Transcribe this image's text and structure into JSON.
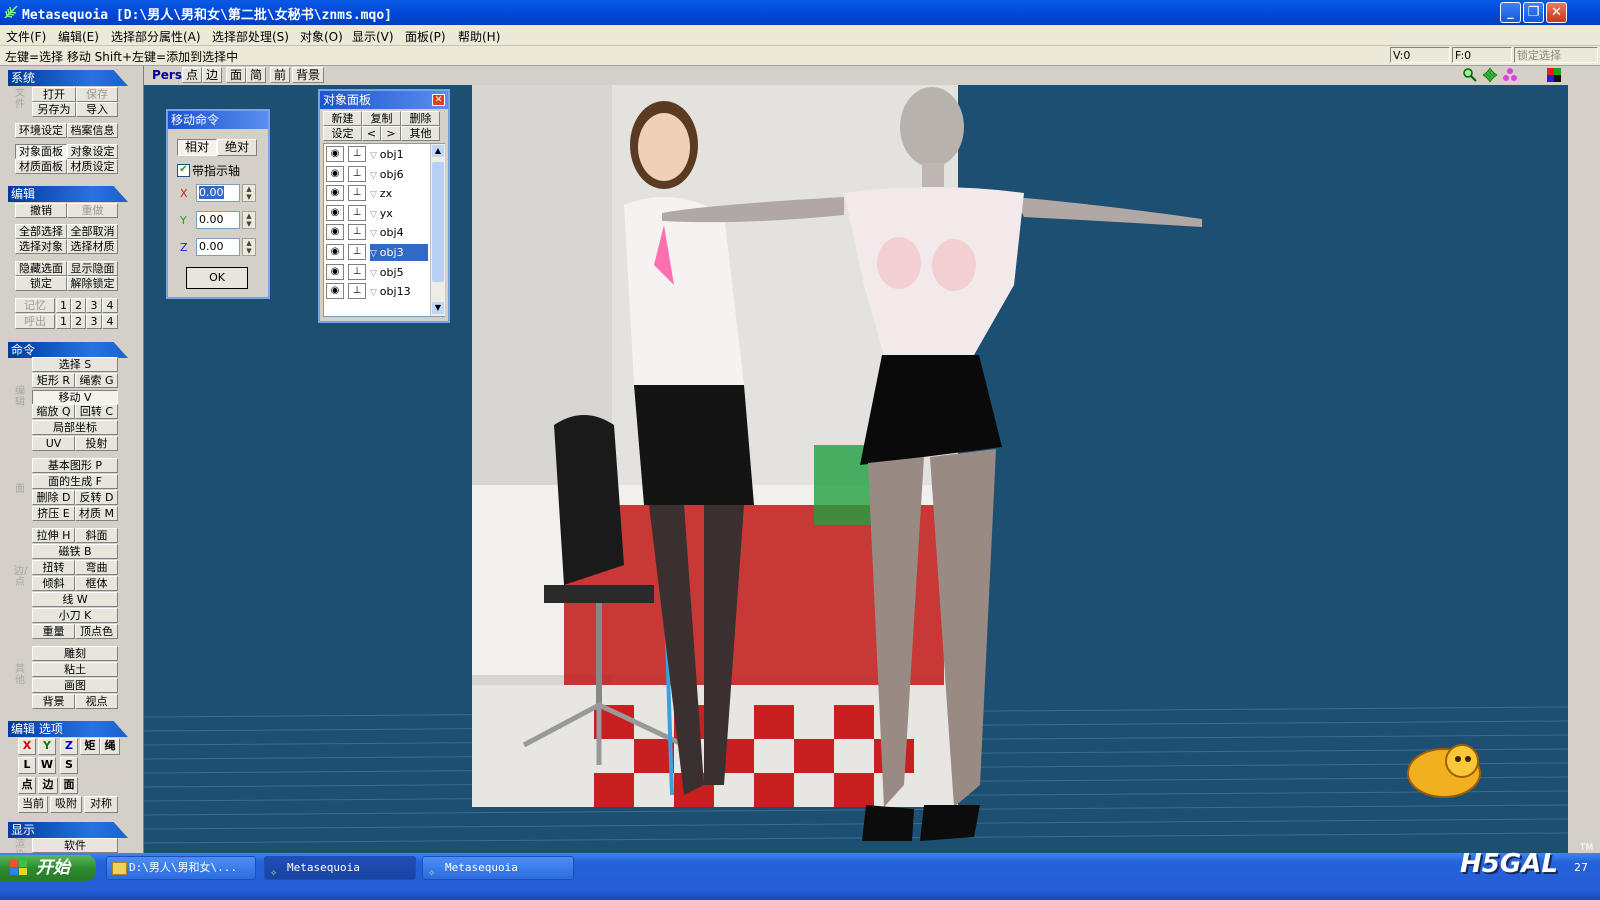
{
  "window": {
    "title": "Metasequoia [D:\\男人\\男和女\\第二批\\女秘书\\znms.mqo]",
    "buttons": {
      "minimize": "_",
      "maximize": "❐",
      "close": "✕"
    }
  },
  "menu": [
    "文件(F)",
    "编辑(E)",
    "选择部分属性(A)",
    "选择部处理(S)",
    "对象(O)",
    "显示(V)",
    "面板(P)",
    "帮助(H)"
  ],
  "status": {
    "hint": "左键=选择 移动  Shift+左键=添加到选择中",
    "vertex": "V:0",
    "face": "F:0",
    "lock": "锁定选择"
  },
  "viewbar": {
    "mode": "Pers",
    "buttons": [
      "点",
      "边",
      "面",
      "简",
      "前",
      "背景"
    ]
  },
  "left": {
    "system": {
      "header": "系统",
      "group_label": "文件",
      "open": "打开",
      "save": "保存",
      "save_as": "另存为",
      "import": "导入",
      "env": "环境设定",
      "docinfo": "档案信息",
      "obj_panel": "对象面板",
      "obj_settings": "对象设定",
      "mat_panel": "材质面板",
      "mat_settings": "材质设定"
    },
    "edit": {
      "header": "编辑",
      "undo": "撤销",
      "redo": "重做",
      "select_all": "全部选择",
      "deselect_all": "全部取消",
      "select_obj": "选择对象",
      "select_mat": "选择材质",
      "hide_sel": "隐藏选面",
      "show_hidden": "显示隐面",
      "lock": "锁定",
      "unlock": "解除锁定",
      "memory": "记忆",
      "recall": "呼出",
      "slots": [
        "1",
        "2",
        "3",
        "4"
      ]
    },
    "command": {
      "header": "命令",
      "g1_label": "编辑",
      "select": "选择 S",
      "rect": "矩形 R",
      "lasso": "绳索 G",
      "move": "移动 V",
      "scale": "缩放 Q",
      "rotate": "回转 C",
      "local": "局部坐标",
      "uv": "UV",
      "project": "投射",
      "g2_label": "面",
      "primitive": "基本图形 P",
      "face_gen": "面的生成 F",
      "delete": "删除 D",
      "flip": "反转 D",
      "extrude": "挤压 E",
      "material": "材质 M",
      "g3_label": "边/点",
      "stretch": "拉伸 H",
      "bevel": "斜面",
      "magnet": "磁铁 B",
      "twist": "扭转",
      "bend": "弯曲",
      "tilt": "倾斜",
      "lattice": "框体",
      "line": "线 W",
      "knife": "小刀 K",
      "weight": "重量",
      "vcolor": "顶点色",
      "g4_label": "其他",
      "sculpt": "雕刻",
      "paste": "粘土",
      "paint": "画图",
      "background": "背景",
      "viewpoint": "视点"
    },
    "edit_options": {
      "header": "编辑 选项",
      "x": "X",
      "y": "Y",
      "z": "Z",
      "rect": "矩",
      "rope": "绳",
      "l": "L",
      "w": "W",
      "s": "S",
      "point": "点",
      "edge": "边",
      "face": "面",
      "front": "当前",
      "snap": "吸附",
      "sym": "对称"
    },
    "display": {
      "header": "显示",
      "label": "渲染",
      "soft": "软件"
    }
  },
  "move_dialog": {
    "title": "移动命令",
    "relative": "相对",
    "absolute": "绝对",
    "axis_label": "带指示轴",
    "axis_checked": true,
    "x_label": "X",
    "x_value": "0.00",
    "y_label": "Y",
    "y_value": "0.00",
    "z_label": "Z",
    "z_value": "0.00",
    "ok": "OK"
  },
  "object_panel": {
    "title": "对象面板",
    "new": "新建",
    "copy": "复制",
    "delete": "删除",
    "settings": "设定",
    "prev": "<",
    "next": ">",
    "other": "其他",
    "objects": [
      {
        "name": "obj1",
        "selected": false
      },
      {
        "name": "obj6",
        "selected": false
      },
      {
        "name": "zx",
        "selected": false
      },
      {
        "name": "yx",
        "selected": false
      },
      {
        "name": "obj4",
        "selected": false
      },
      {
        "name": "obj3",
        "selected": true
      },
      {
        "name": "obj5",
        "selected": false
      },
      {
        "name": "obj13",
        "selected": false
      }
    ]
  },
  "taskbar": {
    "start": "开始",
    "tasks": [
      "D:\\男人\\男和女\\...",
      "Metasequoia",
      "Metasequoia"
    ],
    "clock": "27",
    "watermark": "H5GAL",
    "watermark_tm": "TM"
  },
  "colors": {
    "viewport_bg": "#1d4f72",
    "title_bar": "#0046d5",
    "panel_header": "#1c5fd0",
    "selected_row": "#316ac5"
  }
}
